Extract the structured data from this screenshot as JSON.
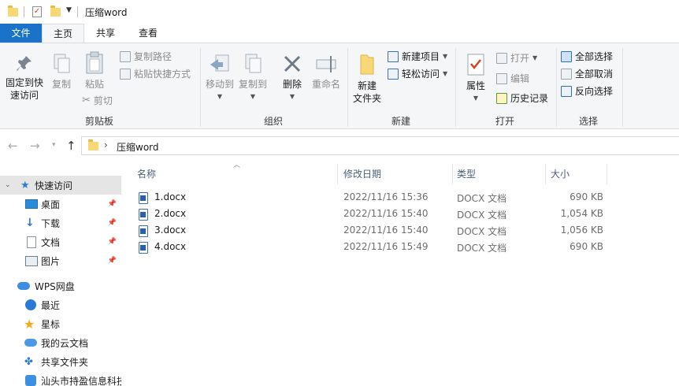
{
  "window": {
    "title": "压缩word"
  },
  "ribbon_tabs": {
    "file": "文件",
    "home": "主页",
    "share": "共享",
    "view": "查看"
  },
  "ribbon": {
    "clipboard": {
      "label": "剪贴板",
      "pin": "固定到快\n速访问",
      "copy": "复制",
      "paste": "粘贴",
      "copy_path": "复制路径",
      "paste_shortcut": "粘贴快捷方式",
      "cut": "剪切"
    },
    "organize": {
      "label": "组织",
      "move_to": "移动到",
      "copy_to": "复制到",
      "delete": "删除",
      "rename": "重命名"
    },
    "new": {
      "label": "新建",
      "new_folder": "新建\n文件夹",
      "new_item": "新建项目",
      "easy_access": "轻松访问"
    },
    "open": {
      "label": "打开",
      "properties": "属性",
      "open": "打开",
      "edit": "编辑",
      "history": "历史记录"
    },
    "select": {
      "label": "选择",
      "select_all": "全部选择",
      "select_none": "全部取消",
      "invert": "反向选择"
    }
  },
  "address": {
    "path": "压缩word"
  },
  "sidebar": {
    "items": [
      {
        "label": "快速访问",
        "icon": "star-icon",
        "selected": true
      },
      {
        "label": "桌面",
        "icon": "desktop-icon",
        "pinned": true
      },
      {
        "label": "下载",
        "icon": "download-icon",
        "pinned": true
      },
      {
        "label": "文档",
        "icon": "document-icon",
        "pinned": true
      },
      {
        "label": "图片",
        "icon": "picture-icon",
        "pinned": true
      },
      {
        "label": "WPS网盘",
        "icon": "cloud-icon"
      },
      {
        "label": "最近",
        "icon": "clock-icon"
      },
      {
        "label": "星标",
        "icon": "star-gold-icon"
      },
      {
        "label": "我的云文档",
        "icon": "cloud-doc-icon"
      },
      {
        "label": "共享文件夹",
        "icon": "share-folder-icon"
      },
      {
        "label": "汕头市持盈信息科技",
        "icon": "org-icon"
      }
    ]
  },
  "columns": {
    "name": "名称",
    "modified": "修改日期",
    "type": "类型",
    "size": "大小"
  },
  "files": [
    {
      "name": "1.docx",
      "modified": "2022/11/16 15:36",
      "type": "DOCX 文档",
      "size": "690 KB"
    },
    {
      "name": "2.docx",
      "modified": "2022/11/16 15:40",
      "type": "DOCX 文档",
      "size": "1,054 KB"
    },
    {
      "name": "3.docx",
      "modified": "2022/11/16 15:40",
      "type": "DOCX 文档",
      "size": "1,056 KB"
    },
    {
      "name": "4.docx",
      "modified": "2022/11/16 15:49",
      "type": "DOCX 文档",
      "size": "690 KB"
    }
  ],
  "colors": {
    "file_tab": "#1a73c8",
    "folder": "#f8d775",
    "accent": "#0078d7"
  }
}
